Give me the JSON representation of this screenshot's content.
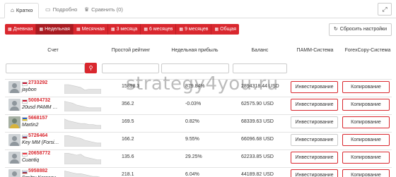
{
  "tabs": [
    {
      "label": "Кратко",
      "icon": "home-icon",
      "glyph": "⌂"
    },
    {
      "label": "Подробно",
      "icon": "document-icon",
      "glyph": "▭"
    },
    {
      "label": "Сравнить (0)",
      "icon": "trophy-icon",
      "glyph": "♛"
    }
  ],
  "expand_icon": "expand-icon",
  "periods": [
    {
      "label": "Дневная",
      "icon": "calendar-icon"
    },
    {
      "label": "Недельная",
      "icon": "calendar-icon",
      "active": true
    },
    {
      "label": "Месячная",
      "icon": "calendar-icon"
    },
    {
      "label": "3 месяца",
      "icon": "calendar-icon"
    },
    {
      "label": "6 месяцев",
      "icon": "calendar-icon"
    },
    {
      "label": "9 месяцев",
      "icon": "calendar-icon"
    },
    {
      "label": "Общая",
      "icon": "calendar-icon"
    }
  ],
  "reset_label": "Сбросить настройки",
  "columns": {
    "account": "Счет",
    "rating": "Простой рейтинг",
    "weekly": "Недельная прибыль",
    "balance": "Баланс",
    "pamm": "ПАММ-Система",
    "forexcopy": "ForexCopy-Система"
  },
  "search_icon": "search-icon",
  "rows": [
    {
      "flag": "us",
      "account": "2733292",
      "name": "jaybon",
      "rating": "15898.3",
      "weekly": "879.84%",
      "balance": "2894318.44 USD",
      "pamm": "Инвестирование",
      "pamm_enabled": true,
      "copy": "Копирование",
      "spark": [
        10,
        10,
        9,
        8,
        7,
        4,
        5,
        5,
        5,
        5
      ]
    },
    {
      "flag": "us",
      "account": "50084732",
      "name": "20usd PAMM …",
      "rating": "356.2",
      "weekly": "-0.03%",
      "balance": "62575.90 USD",
      "pamm": "Инвестирование",
      "pamm_enabled": true,
      "copy": "Копирование",
      "spark": [
        11,
        10,
        9,
        7,
        6,
        5,
        4,
        4,
        4,
        4
      ]
    },
    {
      "flag": "ua",
      "account": "5668157",
      "name": "Martin2",
      "rating": "169.5",
      "weekly": "0.82%",
      "balance": "68339.63 USD",
      "pamm": "Инвестирование",
      "pamm_enabled": false,
      "copy": "Копирование",
      "spark": [
        11,
        9,
        8,
        7,
        6,
        6,
        5,
        5,
        4,
        4
      ]
    },
    {
      "flag": "ru",
      "account": "5726464",
      "name": "Key MM (Forsi…",
      "rating": "166.2",
      "weekly": "9.55%",
      "balance": "66096.68 USD",
      "pamm": "Инвестирование",
      "pamm_enabled": false,
      "copy": "Копирование",
      "spark": [
        12,
        12,
        11,
        10,
        9,
        7,
        6,
        5,
        4,
        4
      ]
    },
    {
      "flag": "sg",
      "account": "20658772",
      "name": "Cuantiq",
      "rating": "135.6",
      "weekly": "29.25%",
      "balance": "62233.85 USD",
      "pamm": "Инвестирование",
      "pamm_enabled": true,
      "copy": "Копирование",
      "spark": [
        12,
        12,
        11,
        10,
        11,
        8,
        7,
        6,
        5,
        5
      ]
    },
    {
      "flag": "ru",
      "account": "5958882",
      "name": "Dmitry Karasev…",
      "rating": "218.1",
      "weekly": "6.04%",
      "balance": "44189.82 USD",
      "pamm": "Инвестирование",
      "pamm_enabled": true,
      "copy": "Копирование",
      "spark": [
        12,
        11,
        10,
        9,
        9,
        8,
        7,
        6,
        6,
        5
      ]
    }
  ],
  "watermark": "strategy4you.ru",
  "colors": {
    "accent": "#d9272e",
    "accent_dark": "#a81b21"
  }
}
